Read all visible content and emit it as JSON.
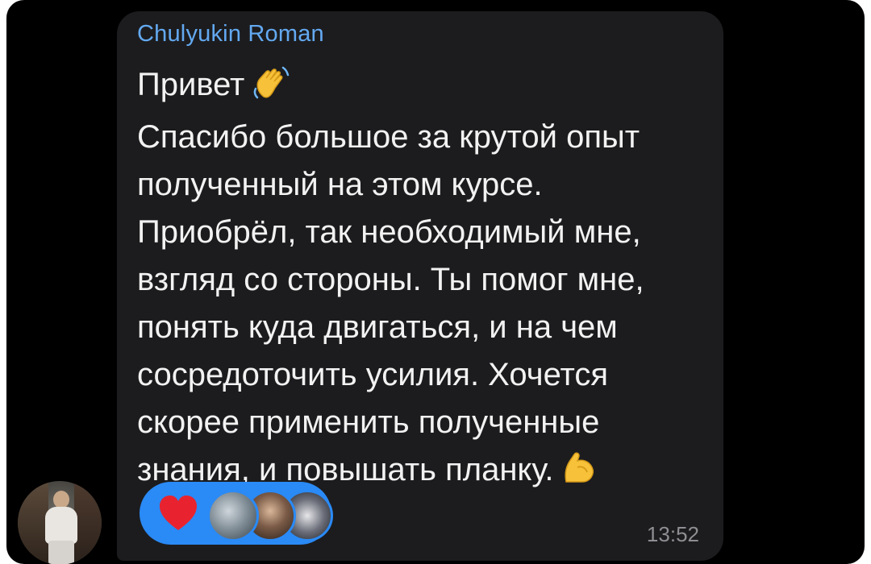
{
  "message": {
    "sender_name": "Chulyukin Roman",
    "lines": [
      "Привет",
      "Спасибо большое за крутой опыт",
      "полученный на этом курсе.",
      "Приобрёл, так необходимый мне,",
      "взгляд со стороны. Ты помог мне,",
      "понять куда двигаться, и на чем",
      "сосредоточить усилия. Хочется",
      "скорее применить полученные",
      "знания, и повышать планку."
    ],
    "time": "13:52",
    "emojis": [
      "waving-hand-icon",
      "flexed-biceps-icon"
    ]
  },
  "reactions": {
    "emoji": "heart-icon",
    "reactor_avatars": [
      "reactor-avatar-1",
      "reactor-avatar-2",
      "reactor-avatar-3"
    ],
    "pill_color": "#2a8af6"
  },
  "colors": {
    "background": "#000000",
    "bubble": "#1c1c1e",
    "sender_name": "#63a9f1",
    "text": "#f2f2f2",
    "time": "#8e8e93",
    "heart": "#e8232f"
  }
}
